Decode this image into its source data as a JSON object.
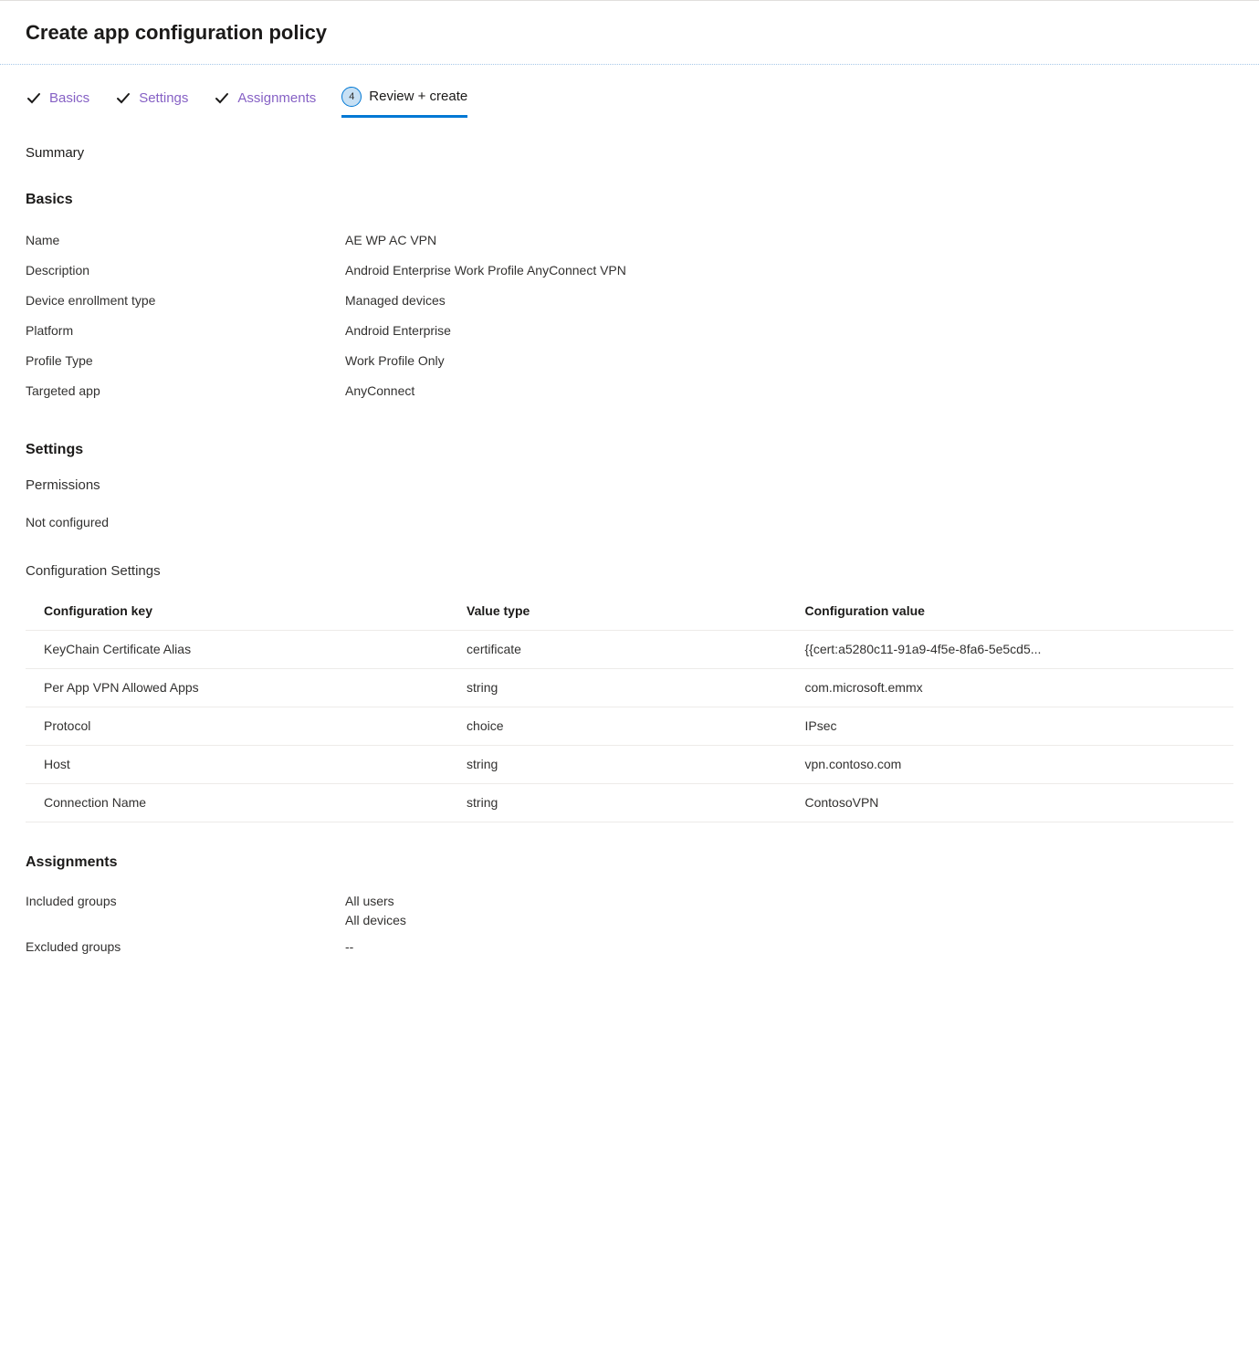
{
  "page_title": "Create app configuration policy",
  "tabs": {
    "basics": "Basics",
    "settings": "Settings",
    "assignments": "Assignments",
    "review_number": "4",
    "review": "Review + create"
  },
  "summary_label": "Summary",
  "basics": {
    "heading": "Basics",
    "rows": [
      {
        "key": "Name",
        "value": "AE WP AC VPN"
      },
      {
        "key": "Description",
        "value": "Android Enterprise Work Profile AnyConnect VPN"
      },
      {
        "key": "Device enrollment type",
        "value": "Managed devices"
      },
      {
        "key": "Platform",
        "value": "Android Enterprise"
      },
      {
        "key": "Profile Type",
        "value": "Work Profile Only"
      },
      {
        "key": "Targeted app",
        "value": "AnyConnect"
      }
    ]
  },
  "settings": {
    "heading": "Settings",
    "permissions_label": "Permissions",
    "permissions_value": "Not configured",
    "config_settings_label": "Configuration Settings",
    "table_headers": {
      "key": "Configuration key",
      "type": "Value type",
      "value": "Configuration value"
    },
    "config_rows": [
      {
        "key": "KeyChain Certificate Alias",
        "type": "certificate",
        "value": "{{cert:a5280c11-91a9-4f5e-8fa6-5e5cd5..."
      },
      {
        "key": "Per App VPN Allowed Apps",
        "type": "string",
        "value": "com.microsoft.emmx"
      },
      {
        "key": "Protocol",
        "type": "choice",
        "value": "IPsec"
      },
      {
        "key": "Host",
        "type": "string",
        "value": "vpn.contoso.com"
      },
      {
        "key": "Connection Name",
        "type": "string",
        "value": "ContosoVPN"
      }
    ]
  },
  "assignments": {
    "heading": "Assignments",
    "included_label": "Included groups",
    "included_values": [
      "All users",
      "All devices"
    ],
    "excluded_label": "Excluded groups",
    "excluded_value": "--"
  }
}
